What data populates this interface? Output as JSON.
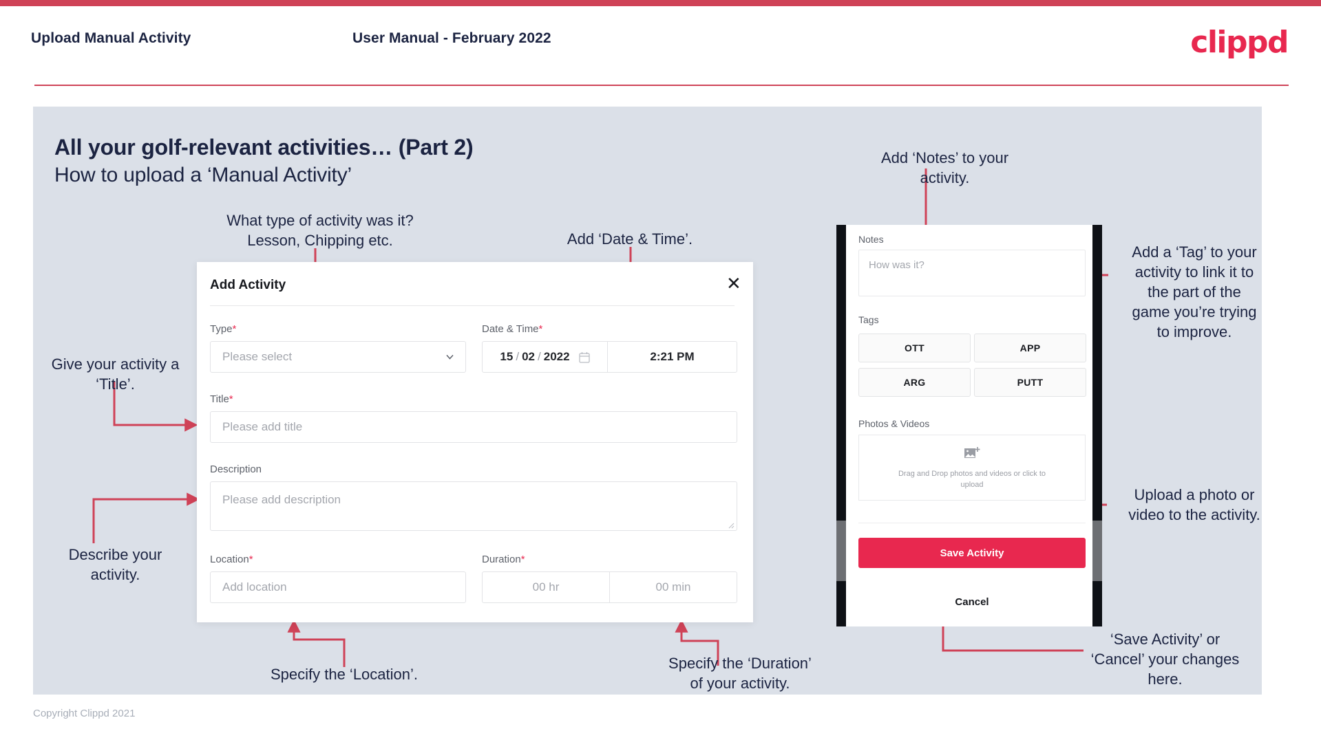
{
  "header": {
    "left_title": "Upload Manual Activity",
    "center_title": "User Manual - February 2022",
    "logo": "clippd"
  },
  "slide": {
    "title": "All your golf-relevant activities… (Part 2)",
    "subtitle": "How to upload a ‘Manual Activity’"
  },
  "annotations": {
    "type": "What type of activity was it?\nLesson, Chipping etc.",
    "datetime": "Add ‘Date & Time’.",
    "title_field": "Give your activity a\n‘Title’.",
    "description": "Describe your\nactivity.",
    "location": "Specify the ‘Location’.",
    "duration": "Specify the ‘Duration’\nof your activity.",
    "notes": "Add ‘Notes’ to your\nactivity.",
    "tags": "Add a ‘Tag’ to your\nactivity to link it to\nthe part of the\ngame you’re trying\nto improve.",
    "photos": "Upload a photo or\nvideo to the activity.",
    "save_cancel": "‘Save Activity’ or\n‘Cancel’ your changes\nhere."
  },
  "modal": {
    "title": "Add Activity",
    "close_label": "✕",
    "fields": {
      "type": {
        "label": "Type",
        "required": "*",
        "placeholder": "Please select"
      },
      "datetime": {
        "label": "Date & Time",
        "required": "*",
        "day": "15",
        "month": "02",
        "year": "2022",
        "sep": "/",
        "time": "2:21 PM"
      },
      "title": {
        "label": "Title",
        "required": "*",
        "placeholder": "Please add title"
      },
      "description": {
        "label": "Description",
        "required": "",
        "placeholder": "Please add description"
      },
      "location": {
        "label": "Location",
        "required": "*",
        "placeholder": "Add location"
      },
      "duration": {
        "label": "Duration",
        "required": "*",
        "hours_placeholder": "00 hr",
        "minutes_placeholder": "00 min"
      }
    }
  },
  "phone": {
    "notes": {
      "label": "Notes",
      "placeholder": "How was it?"
    },
    "tags": {
      "label": "Tags",
      "options": [
        "OTT",
        "APP",
        "ARG",
        "PUTT"
      ]
    },
    "photos": {
      "label": "Photos & Videos",
      "drop_text": "Drag and Drop photos and videos or click to upload"
    },
    "save_label": "Save Activity",
    "cancel_label": "Cancel"
  },
  "footer": {
    "copyright": "Copyright Clippd 2021"
  },
  "colors": {
    "accent": "#e8284f",
    "header_rule": "#cf4257",
    "slide_bg": "#dbe0e8",
    "text_dark": "#1b2341",
    "annotation_line": "#cf4257"
  }
}
